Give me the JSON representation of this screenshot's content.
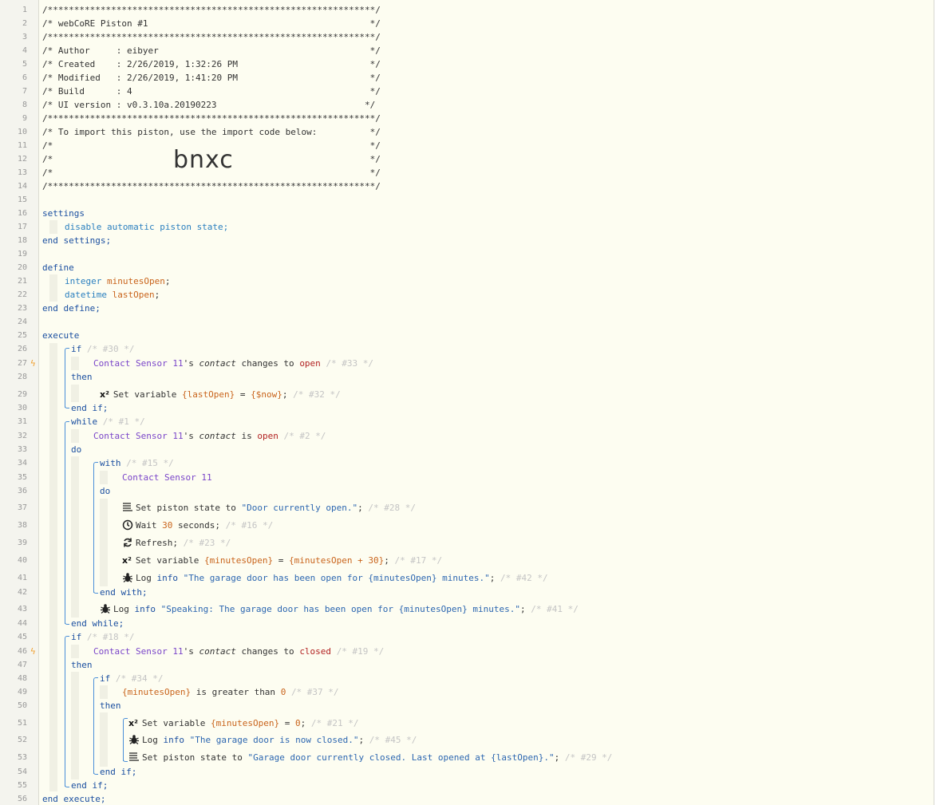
{
  "header_comment": {
    "border": "/**************************************************************/",
    "title": "/* webCoRE Piston #1                                          */",
    "author": "/* Author     : eibyer                                        */",
    "created": "/* Created    : 2/26/2019, 1:32:26 PM                         */",
    "modified": "/* Modified   : 2/26/2019, 1:41:20 PM                         */",
    "build": "/* Build      : 4                                             */",
    "ui_version": "/* UI version : v0.3.10a.20190223                            */",
    "import_text": "/* To import this piston, use the import code below:          */",
    "blank": "/*                                                            */",
    "import_code": "bnxc"
  },
  "kw": {
    "settings": "settings",
    "end_settings": "end settings;",
    "define": "define",
    "end_define": "end define;",
    "execute": "execute",
    "end_execute": "end execute;",
    "if": "if",
    "then": "then",
    "end_if": "end if;",
    "while": "while",
    "do": "do",
    "with": "with",
    "end_with": "end with;",
    "end_while": "end while;"
  },
  "settings_line": "disable automatic piston state;",
  "vars": {
    "integer_type": "integer",
    "minutes_open": "minutesOpen",
    "datetime_type": "datetime",
    "last_open": "lastOpen"
  },
  "comments": {
    "c30": "/* #30 */",
    "c33": "/* #33 */",
    "c32": "/* #32 */",
    "c1": "/* #1 */",
    "c2": "/* #2 */",
    "c15": "/* #15 */",
    "c28": "/* #28 */",
    "c16": "/* #16 */",
    "c23": "/* #23 */",
    "c17": "/* #17 */",
    "c42": "/* #42 */",
    "c41": "/* #41 */",
    "c18": "/* #18 */",
    "c19": "/* #19 */",
    "c34": "/* #34 */",
    "c37": "/* #37 */",
    "c21": "/* #21 */",
    "c45": "/* #45 */",
    "c29": "/* #29 */"
  },
  "device": "Contact Sensor 11",
  "attr_contact": "contact",
  "words": {
    "s_suffix": "'s",
    "changes_to": "changes to",
    "is": "is",
    "open": "open",
    "closed": "closed",
    "is_greater_than": "is greater than",
    "set_variable": "Set variable",
    "set_piston_state_to": "Set piston state to",
    "wait": "Wait",
    "seconds": "seconds;",
    "refresh": "Refresh;",
    "log": "Log",
    "info": "info",
    "eq": "=",
    "semi": ";",
    "x2": "x²"
  },
  "values": {
    "last_open_var": "{lastOpen}",
    "now": "{$now}",
    "minutes_open_var": "{minutesOpen}",
    "minutes_plus": "{minutesOpen + 30}",
    "thirty": "30",
    "zero": "0",
    "door_open_state": "\"Door currently open.\"",
    "log1": "\"The garage door has been open for {minutesOpen} minutes.\"",
    "log2": "\"Speaking: The garage door has been open for {minutesOpen} minutes.\"",
    "log3": "\"The garage door is now closed.\"",
    "closed_state": "\"Garage door currently closed. Last opened at {lastOpen}.\""
  },
  "colors": {
    "keyword": "#1b4fa0",
    "device": "#7a45c9",
    "variable": "#c9641c",
    "string": "#2c66b0",
    "trigger": "#f0a030"
  }
}
